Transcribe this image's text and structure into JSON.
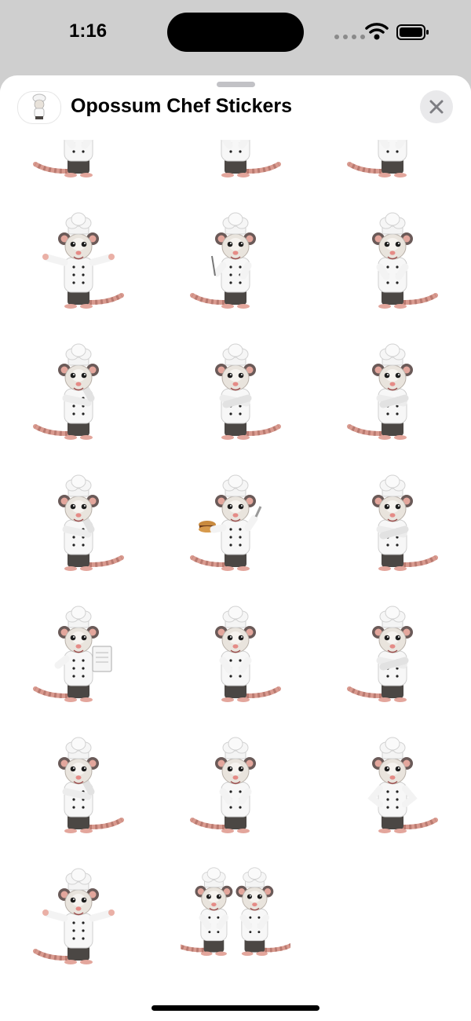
{
  "status_bar": {
    "time": "1:16"
  },
  "sheet": {
    "title": "Opossum Chef Stickers",
    "close_label": "×"
  },
  "stickers": [
    {
      "name": "sticker-1",
      "pose": "standing"
    },
    {
      "name": "sticker-2",
      "pose": "standing"
    },
    {
      "name": "sticker-3",
      "pose": "standing"
    },
    {
      "name": "sticker-4",
      "pose": "arms-out"
    },
    {
      "name": "sticker-5",
      "pose": "holding-fork"
    },
    {
      "name": "sticker-6",
      "pose": "hands-together"
    },
    {
      "name": "sticker-7",
      "pose": "thinking"
    },
    {
      "name": "sticker-8",
      "pose": "arms-crossed"
    },
    {
      "name": "sticker-9",
      "pose": "arms-crossed"
    },
    {
      "name": "sticker-10",
      "pose": "thinking"
    },
    {
      "name": "sticker-11",
      "pose": "holding-burger"
    },
    {
      "name": "sticker-12",
      "pose": "arms-crossed"
    },
    {
      "name": "sticker-13",
      "pose": "holding-clipboard"
    },
    {
      "name": "sticker-14",
      "pose": "hands-together"
    },
    {
      "name": "sticker-15",
      "pose": "arms-crossed"
    },
    {
      "name": "sticker-16",
      "pose": "thinking"
    },
    {
      "name": "sticker-17",
      "pose": "standing"
    },
    {
      "name": "sticker-18",
      "pose": "hands-on-hips"
    },
    {
      "name": "sticker-19",
      "pose": "arms-out"
    },
    {
      "name": "sticker-20",
      "pose": "pair"
    }
  ]
}
